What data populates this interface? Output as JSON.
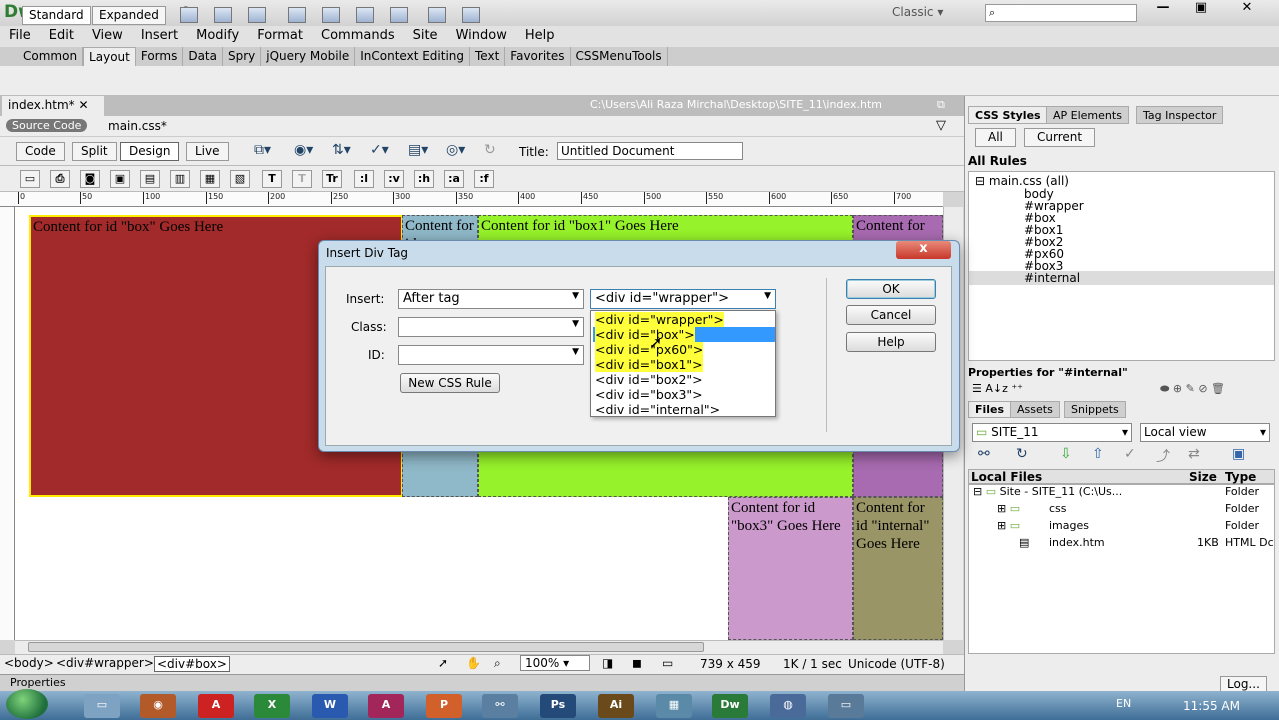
{
  "app": {
    "logo": "Dw",
    "workspace": "Classic"
  },
  "menu": [
    "File",
    "Edit",
    "View",
    "Insert",
    "Modify",
    "Format",
    "Commands",
    "Site",
    "Window",
    "Help"
  ],
  "insert_tabs": [
    "Common",
    "Layout",
    "Forms",
    "Data",
    "Spry",
    "jQuery Mobile",
    "InContext Editing",
    "Text",
    "Favorites",
    "CSSMenuTools"
  ],
  "insert_active": "Layout",
  "insert_buttons": {
    "standard": "Standard",
    "expanded": "Expanded"
  },
  "document": {
    "tab": "index.htm*",
    "path": "C:\\Users\\Ali Raza Mirchal\\Desktop\\SITE_11\\index.htm",
    "source_code": "Source Code",
    "related_file": "main.css*",
    "views": [
      "Code",
      "Split",
      "Design",
      "Live"
    ],
    "title_label": "Title:",
    "title_value": "Untitled Document"
  },
  "format_buttons": [
    "T",
    "T",
    "Tr",
    ":l",
    ":v",
    ":h",
    ":a",
    ":f"
  ],
  "ruler_ticks": [
    "0",
    "50",
    "100",
    "150",
    "200",
    "250",
    "300",
    "350",
    "400",
    "450",
    "500",
    "550",
    "600",
    "650",
    "700"
  ],
  "canvas_boxes": {
    "box": "Content for id \"box\" Goes Here",
    "px60": "Content for id",
    "box1": "Content for id \"box1\" Goes Here",
    "box2": "Content for",
    "box3": "Content for id \"box3\" Goes Here",
    "internal": "Content for id \"internal\" Goes Here"
  },
  "status": {
    "tags": [
      "<body>",
      "<div#wrapper>",
      "<div#box>"
    ],
    "zoom": "100%",
    "size": "739 x 459",
    "download": "1K / 1 sec",
    "encoding": "Unicode (UTF-8)"
  },
  "properties_label": "Properties",
  "css_panel": {
    "tabs": [
      "CSS Styles",
      "AP Elements",
      "Tag Inspector"
    ],
    "buttons": [
      "All",
      "Current"
    ],
    "all_rules": "All Rules",
    "root": "main.css (all)",
    "rules": [
      "body",
      "#wrapper",
      "#box",
      "#box1",
      "#box2",
      "#px60",
      "#box3",
      "#internal"
    ],
    "props_for": "Properties for \"#internal\""
  },
  "files_panel": {
    "tabs": [
      "Files",
      "Assets",
      "Snippets"
    ],
    "site": "SITE_11",
    "view": "Local view",
    "headers": [
      "Local Files",
      "Size",
      "Type"
    ],
    "rows": [
      {
        "name": "Site - SITE_11 (C:\\Us...",
        "size": "",
        "type": "Folder"
      },
      {
        "name": "css",
        "size": "",
        "type": "Folder"
      },
      {
        "name": "images",
        "size": "",
        "type": "Folder"
      },
      {
        "name": "index.htm",
        "size": "1KB",
        "type": "HTML Dc"
      }
    ],
    "log": "Log..."
  },
  "dialog": {
    "title": "Insert Div Tag",
    "insert_label": "Insert:",
    "insert_value": "After tag",
    "tag_value": "<div id=\"wrapper\">",
    "class_label": "Class:",
    "id_label": "ID:",
    "new_css": "New CSS Rule",
    "ok": "OK",
    "cancel": "Cancel",
    "help": "Help",
    "close": "x",
    "options": [
      "<div id=\"wrapper\">",
      "<div id=\"box\">",
      "<div id=\"px60\">",
      "<div id=\"box1\">",
      "<div id=\"box2\">",
      "<div id=\"box3\">",
      "<div id=\"internal\">"
    ]
  },
  "taskbar": {
    "lang": "EN",
    "time": "11:55 AM"
  },
  "colors": {
    "box": "#a22a2a",
    "px60": "#8fb8c8",
    "box1": "#96f22a",
    "box2": "#a86ab0",
    "box3": "#cc99cc",
    "internal": "#9a9566"
  }
}
